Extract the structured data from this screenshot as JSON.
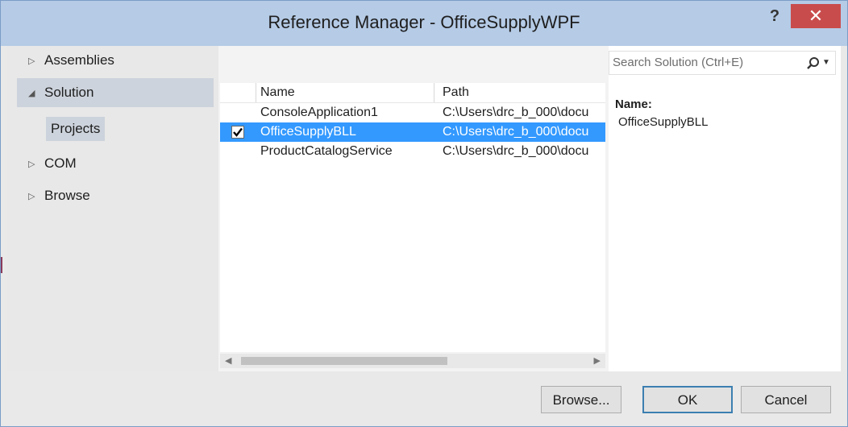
{
  "window": {
    "title": "Reference Manager - OfficeSupplyWPF",
    "help_label": "?",
    "close_label": "✕"
  },
  "sidebar": {
    "items": [
      {
        "label": "Assemblies",
        "expanded": false
      },
      {
        "label": "Solution",
        "expanded": true
      },
      {
        "label": "COM",
        "expanded": false
      },
      {
        "label": "Browse",
        "expanded": false
      }
    ],
    "sub_item": "Projects",
    "arrow_collapsed": "▷",
    "arrow_expanded": "◢"
  },
  "grid": {
    "headers": {
      "name": "Name",
      "path": "Path"
    },
    "rows": [
      {
        "name": "ConsoleApplication1",
        "path": "C:\\Users\\drc_b_000\\docu",
        "checked": false,
        "selected": false
      },
      {
        "name": "OfficeSupplyBLL",
        "path": "C:\\Users\\drc_b_000\\docu",
        "checked": true,
        "selected": true
      },
      {
        "name": "ProductCatalogService",
        "path": "C:\\Users\\drc_b_000\\docu",
        "checked": false,
        "selected": false
      }
    ],
    "scroll_left": "◀",
    "scroll_right": "▶"
  },
  "search": {
    "placeholder": "Search Solution (Ctrl+E)",
    "icon": "search-icon",
    "dropdown": "▼"
  },
  "details": {
    "name_label": "Name:",
    "name_value": "OfficeSupplyBLL"
  },
  "footer": {
    "browse_label": "Browse...",
    "ok_label": "OK",
    "cancel_label": "Cancel"
  },
  "colors": {
    "title_bar": "#b5cbe6",
    "close_button": "#c94c4c",
    "selection": "#3399ff",
    "nav_selected": "#cdd3dc"
  }
}
